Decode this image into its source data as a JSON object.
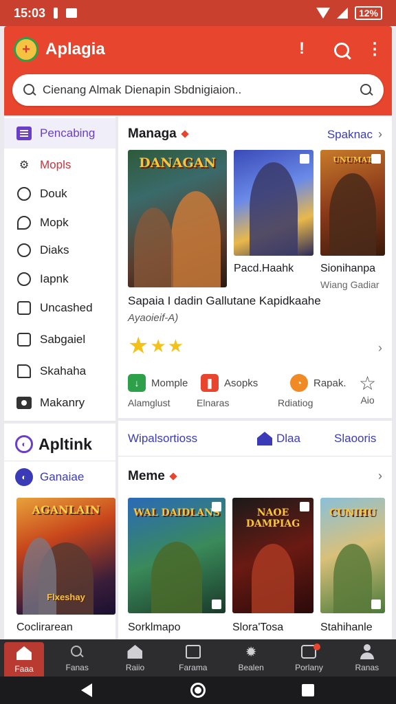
{
  "status_bar": {
    "time": "15:03",
    "battery": "12%"
  },
  "app_bar": {
    "title": "Aplagia",
    "logo_icon": "app-logo",
    "search_placeholder": "Cienang Almak Dienapin Sbdnigiaion.."
  },
  "sidebar": {
    "items": [
      {
        "label": "Pencabing",
        "icon": "list-icon"
      },
      {
        "label": "Mopls",
        "icon": "settings-icon"
      },
      {
        "label": "Douk",
        "icon": "circle-icon"
      },
      {
        "label": "Mopk",
        "icon": "tag-icon"
      },
      {
        "label": "Diaks",
        "icon": "circle-icon"
      },
      {
        "label": "Iapnk",
        "icon": "circle-icon"
      },
      {
        "label": "Uncashed",
        "icon": "square-icon"
      },
      {
        "label": "Sabgaiel",
        "icon": "square-icon"
      },
      {
        "label": "Skahaha",
        "icon": "square-icon"
      },
      {
        "label": "Makanry",
        "icon": "image-icon"
      }
    ]
  },
  "sidebar2": {
    "heading": "Apltink",
    "sub_label": "Ganaiae",
    "cover_title": "AGANLAIN",
    "cover_subtitle": "Flxeshay",
    "caption": "Coclirarean"
  },
  "section1": {
    "title": "Managa",
    "see_all": "Spaknac",
    "featured_cover_title": "DANAGAN",
    "cards": [
      {
        "title": "Pacd.Haahk",
        "subtitle": ""
      },
      {
        "title": "Sionihanpa",
        "subtitle": "Wiang Gadiar",
        "cover_title": "UNUMAT"
      }
    ],
    "featured_title": "Sapaia I dadin Gallutane Kapidkaahe",
    "featured_subtitle": "Ayaoieif-A)",
    "rating": 3,
    "mini_items": [
      {
        "top": "Momple",
        "bottom": "Alamglust",
        "color": "#2ea04a"
      },
      {
        "top": "Asopks",
        "bottom": "Elnaras",
        "color": "#e8452e"
      },
      {
        "top": "Rapak.",
        "bottom": "Rdiatiog",
        "color": "#f08a24"
      },
      {
        "top": "",
        "bottom": "Aio",
        "color": ""
      }
    ]
  },
  "section2": {
    "tabs": [
      "Wipalsortioss",
      "Dlaa",
      "Slaooris"
    ],
    "title": "Meme",
    "cards": [
      {
        "title": "Sorklmapo",
        "cover_title": "WAL DAIDLANS"
      },
      {
        "title": "Slora'Tosa",
        "cover_title": "NAOE DAMPIAG"
      },
      {
        "title": "Stahihanle",
        "cover_title": "CUNIHU"
      }
    ]
  },
  "bottom_nav": [
    "Faaa",
    "Fanas",
    "Raiio",
    "Farama",
    "Bealen",
    "Porlany",
    "Ranas"
  ],
  "colors": {
    "accent": "#e8452e",
    "link": "#3b3bb8",
    "purple": "#6a3ec9",
    "star": "#f3c21a"
  }
}
